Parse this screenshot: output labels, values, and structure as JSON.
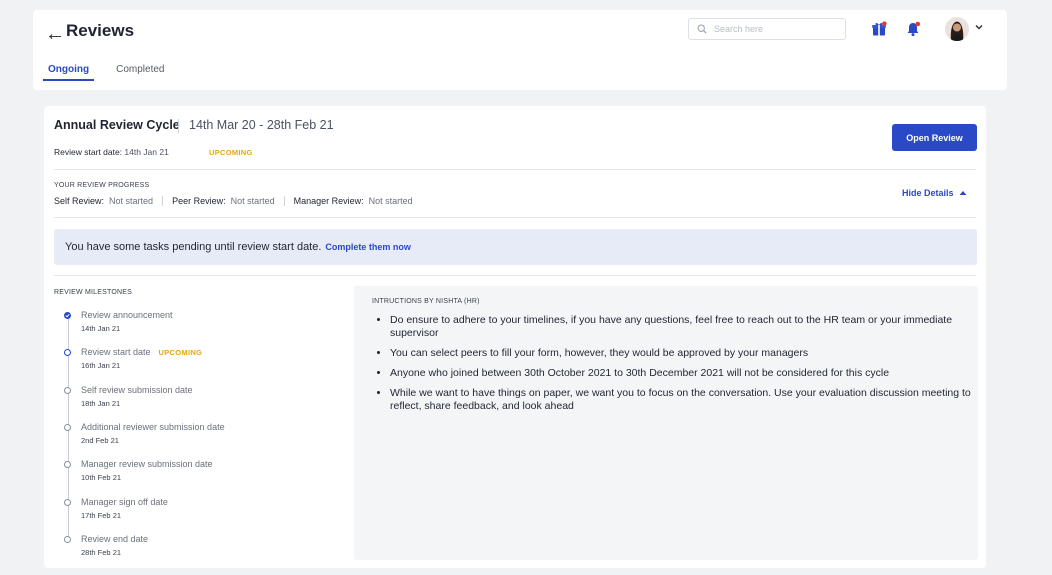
{
  "header": {
    "title": "Reviews",
    "back_icon": "←",
    "tabs": [
      {
        "label": "Ongoing",
        "active": true
      },
      {
        "label": "Completed",
        "active": false
      }
    ],
    "search": {
      "placeholder": "Search here"
    }
  },
  "colors": {
    "accent": "#2a49c6",
    "upcoming": "#e8a418",
    "notification_dot": "#e53935"
  },
  "icons": [
    "back-arrow-icon",
    "search-icon",
    "gift-icon",
    "bell-icon",
    "avatar",
    "chevron-down-icon",
    "check-icon",
    "caret-up-icon"
  ],
  "cycle": {
    "name": "Annual Review Cycle",
    "dates": "14th Mar 20 - 28th Feb 21",
    "start_label": "Review start date:",
    "start_value": "14th Jan 21",
    "status": "UPCOMING",
    "open_button": "Open Review"
  },
  "progress": {
    "heading": "YOUR REVIEW PROGRESS",
    "items": [
      {
        "label": "Self Review:",
        "value": "Not started"
      },
      {
        "label": "Peer Review:",
        "value": "Not started"
      },
      {
        "label": "Manager Review:",
        "value": "Not started"
      }
    ],
    "toggle_label": "Hide Details"
  },
  "notice": {
    "text": "You have some tasks pending until review start date.",
    "link": "Complete them now"
  },
  "milestones": {
    "heading": "REVIEW MILESTONES",
    "items": [
      {
        "title": "Review announcement",
        "date": "14th Jan 21",
        "state": "done",
        "badge": ""
      },
      {
        "title": "Review start date",
        "date": "16th Jan 21",
        "state": "current",
        "badge": "UPCOMING"
      },
      {
        "title": "Self review submission date",
        "date": "18th Jan 21",
        "state": "pending",
        "badge": ""
      },
      {
        "title": "Additional reviewer submission date",
        "date": "2nd Feb 21",
        "state": "pending",
        "badge": ""
      },
      {
        "title": "Manager review submission date",
        "date": "10th Feb 21",
        "state": "pending",
        "badge": ""
      },
      {
        "title": "Manager sign off date",
        "date": "17th Feb 21",
        "state": "pending",
        "badge": ""
      },
      {
        "title": "Review end date",
        "date": "28th Feb 21",
        "state": "pending",
        "badge": ""
      }
    ]
  },
  "instructions": {
    "heading": "INTRUCTIONS BY NISHTA (HR)",
    "items": [
      "Do ensure to adhere to your timelines, if you have any questions, feel free to reach out to the HR team or your immediate supervisor",
      "You can select peers to fill your form, however, they would be approved by your managers",
      "Anyone who joined between 30th October 2021 to 30th December 2021 will not be considered for this cycle",
      "While we want to have things on paper, we want you to focus on the conversation. Use your evaluation discussion meeting to reflect, share feedback, and look ahead"
    ]
  }
}
